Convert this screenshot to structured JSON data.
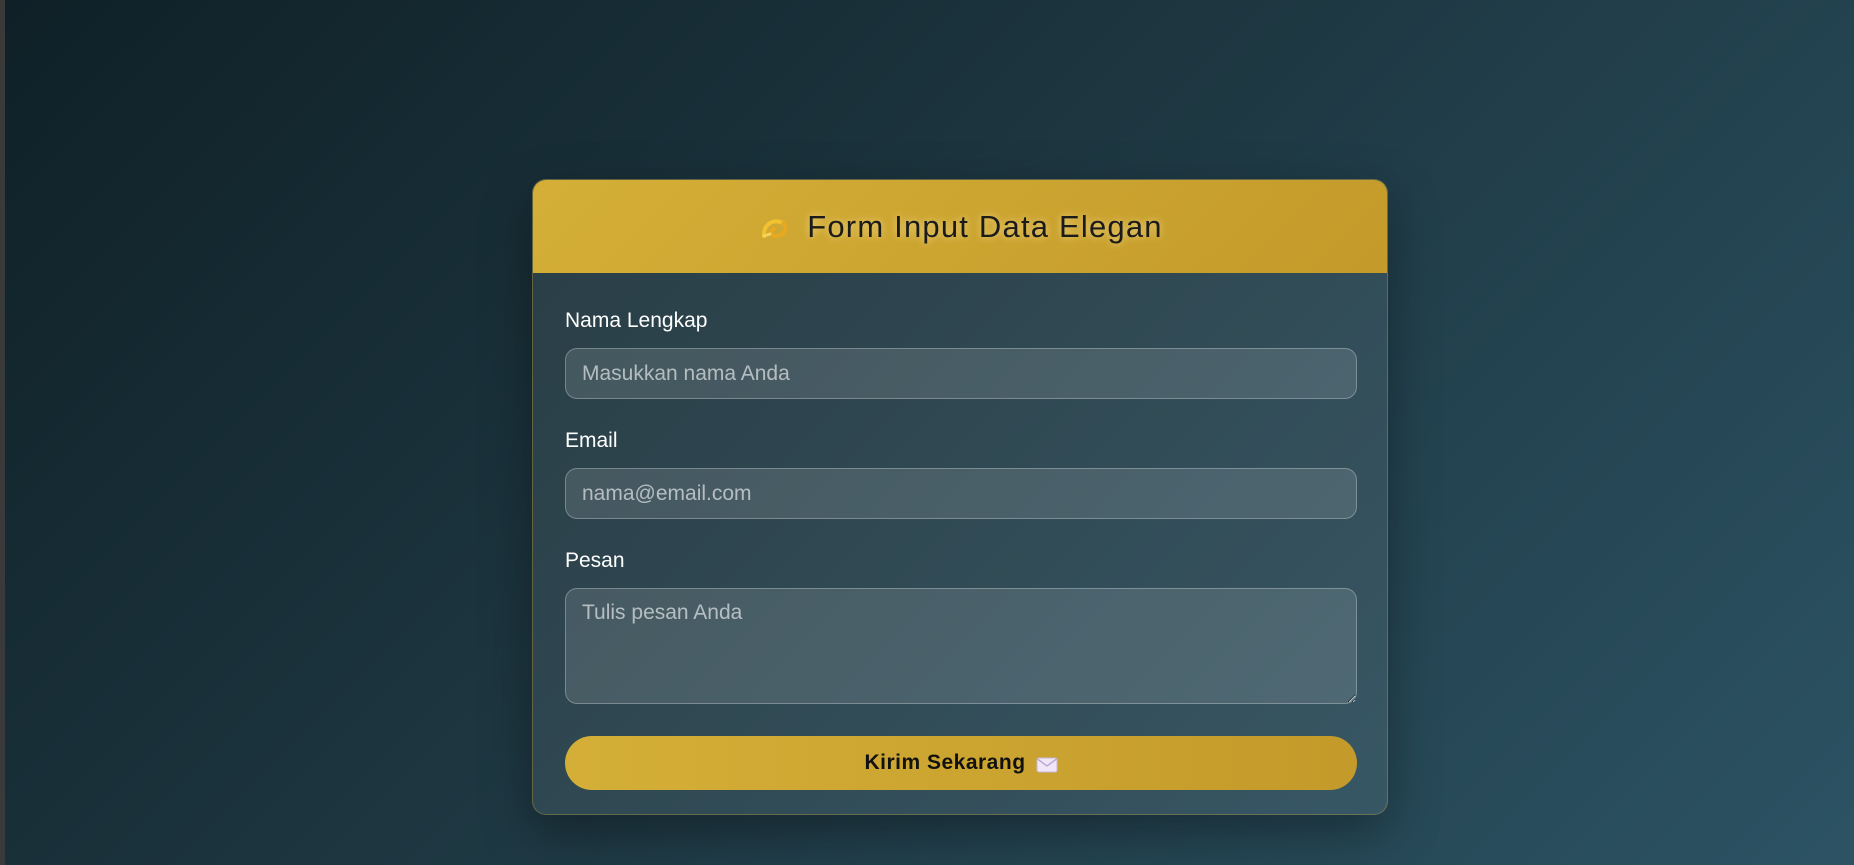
{
  "form": {
    "title": "Form Input Data Elegan",
    "title_icon": "ribbon-emoji-icon",
    "fields": {
      "name": {
        "label": "Nama Lengkap",
        "placeholder": "Masukkan nama Anda",
        "value": ""
      },
      "email": {
        "label": "Email",
        "placeholder": "nama@email.com",
        "value": ""
      },
      "message": {
        "label": "Pesan",
        "placeholder": "Tulis pesan Anda",
        "value": ""
      }
    },
    "submit_label": "Kirim Sekarang",
    "submit_icon": "envelope-icon"
  },
  "colors": {
    "accent_gold": "#d4af37",
    "accent_gold_dark": "#c49a2a",
    "background_start": "#0f2027",
    "background_end": "#2c5364"
  }
}
